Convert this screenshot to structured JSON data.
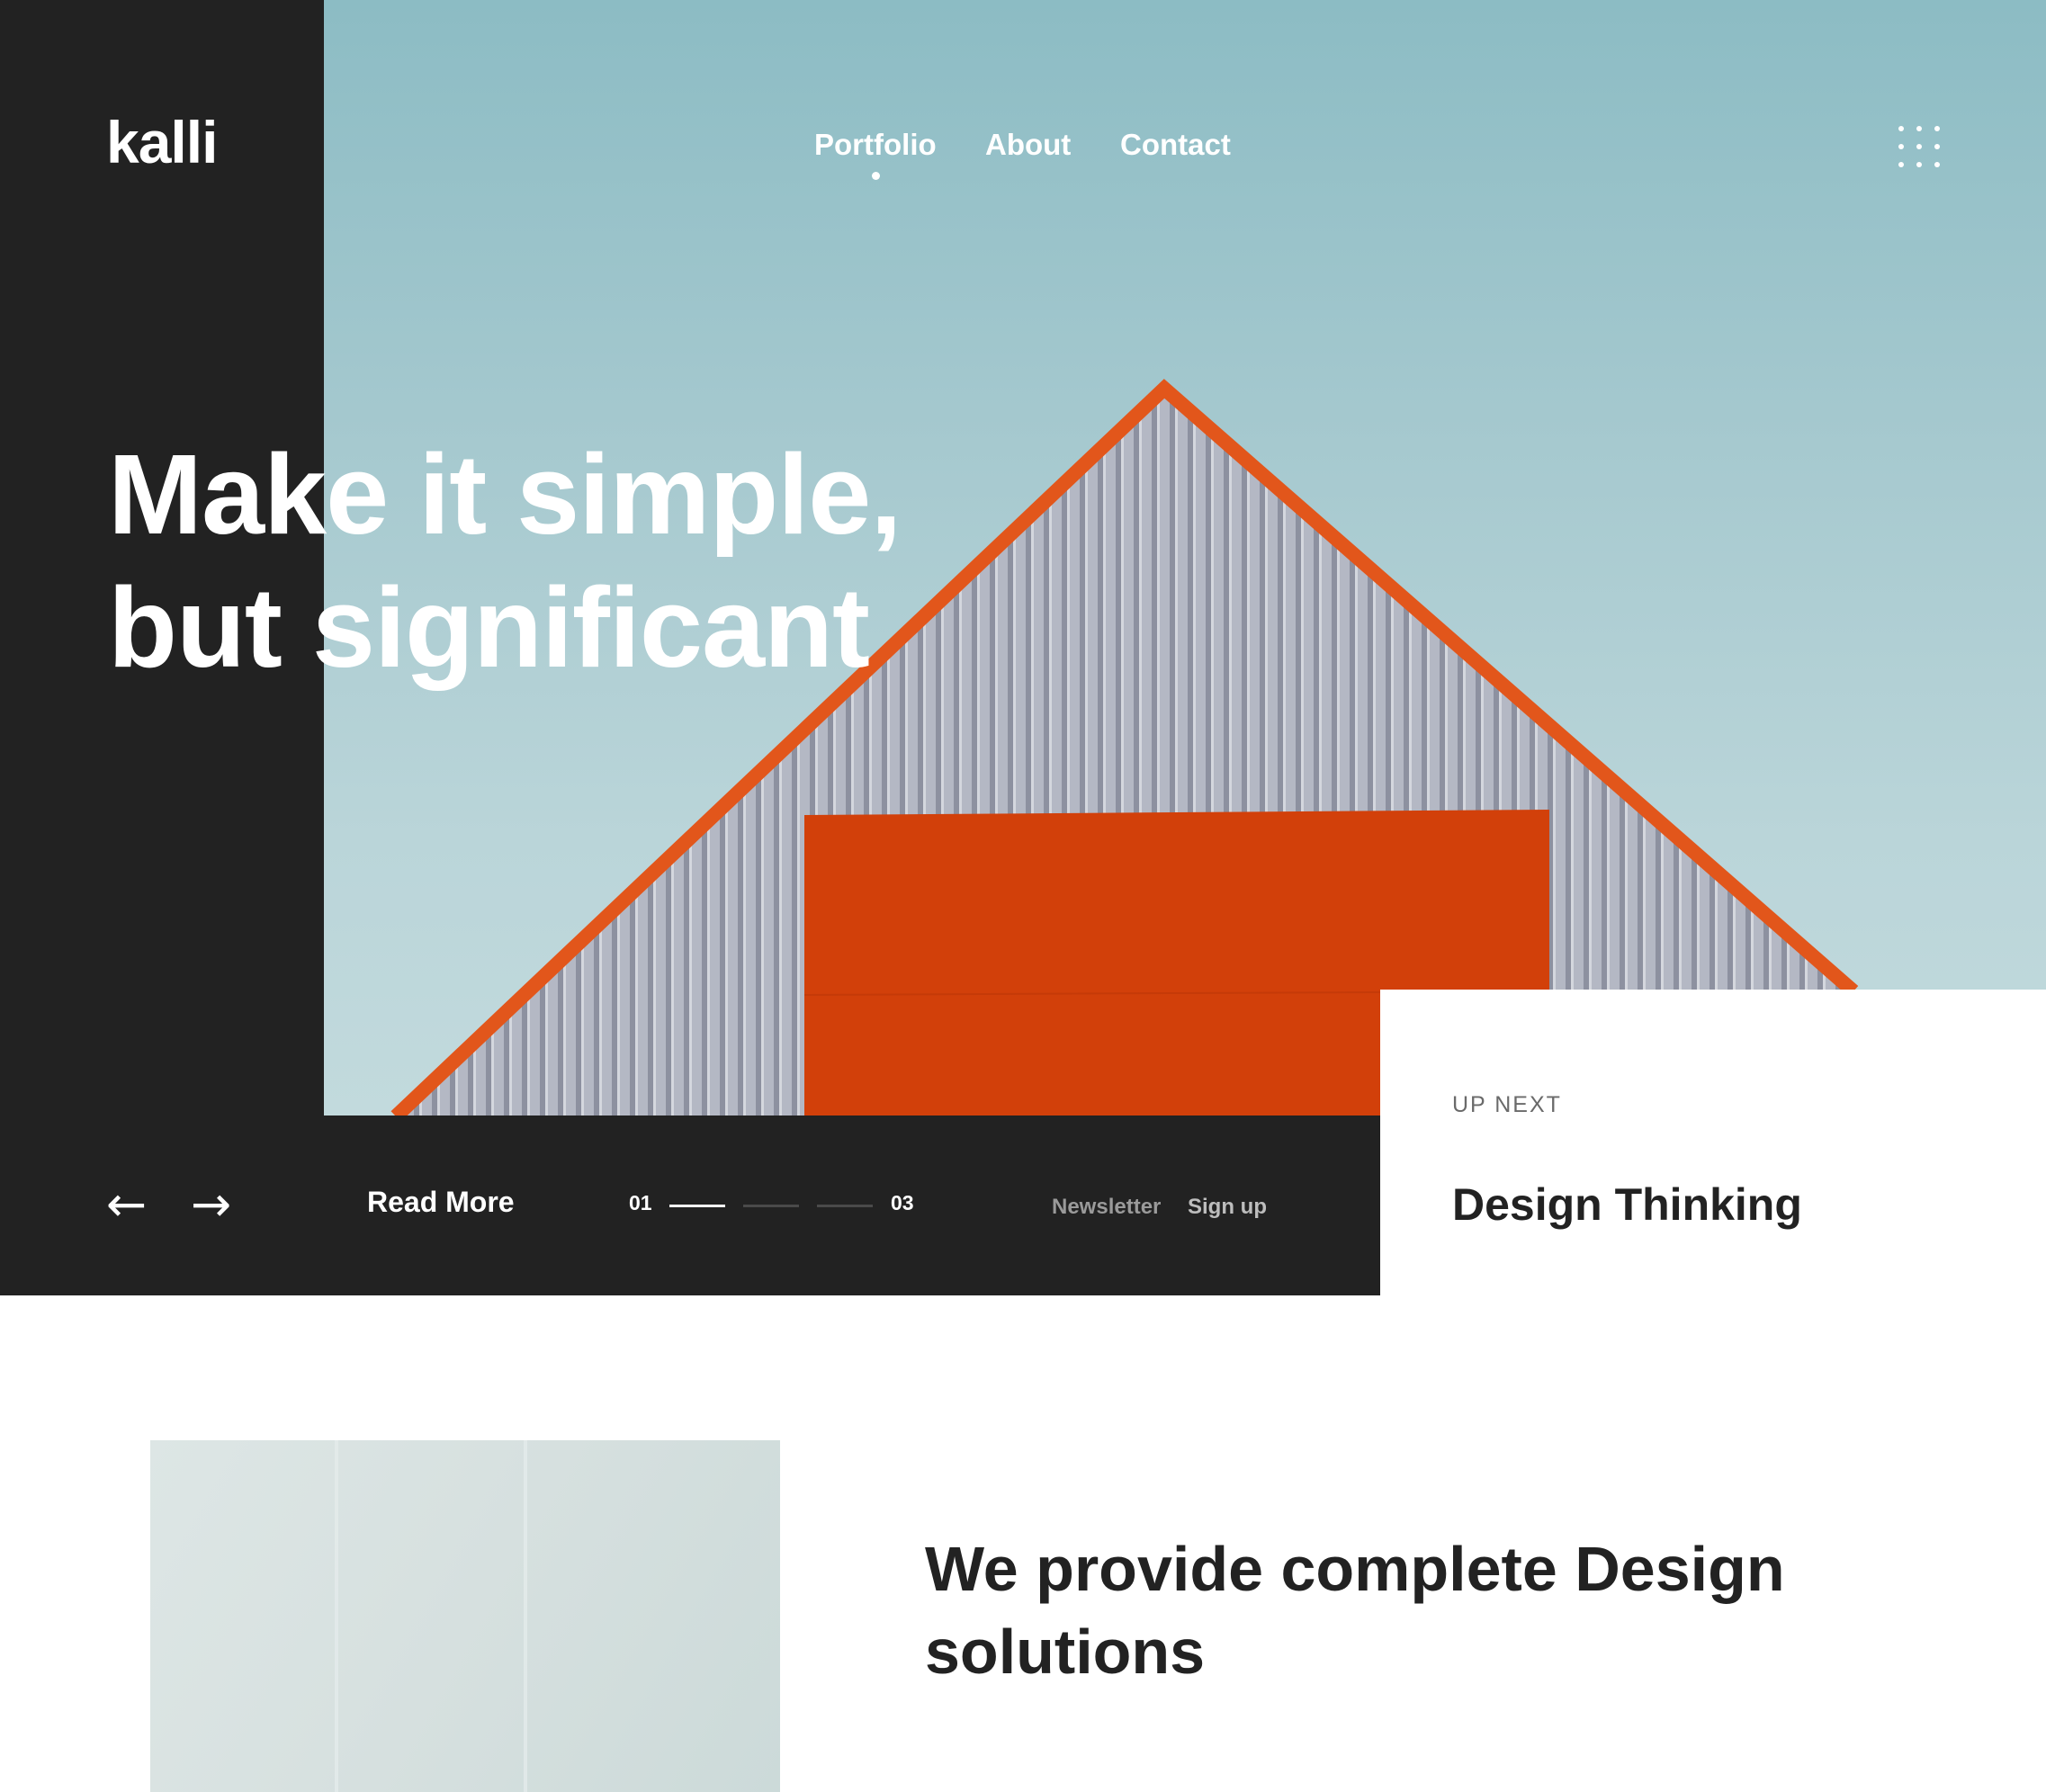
{
  "brand": {
    "logo": "kalli"
  },
  "nav": {
    "items": [
      {
        "label": "Portfolio",
        "active": true
      },
      {
        "label": "About",
        "active": false
      },
      {
        "label": "Contact",
        "active": false
      }
    ],
    "menu_icon": "grid-dots-icon"
  },
  "hero": {
    "headline_line1": "Make it simple,",
    "headline_line2": "but significant",
    "image": "orange roof facade against sky"
  },
  "slider": {
    "prev_icon": "arrow-left-icon",
    "next_icon": "arrow-right-icon",
    "prev_glyph": "←",
    "next_glyph": "→",
    "read_more": "Read More",
    "current": "01",
    "total": "03",
    "progress": 0.33
  },
  "newsletter": {
    "label": "Newsletter",
    "action": "Sign up"
  },
  "up_next": {
    "label": "UP NEXT",
    "title": "Design Thinking"
  },
  "about": {
    "heading": "We provide complete Design solutions"
  },
  "colors": {
    "dark": "#222222",
    "accent_orange": "#d2400a",
    "roof_trim": "#e2561b",
    "sky": "#a6c9cf",
    "white": "#ffffff"
  }
}
